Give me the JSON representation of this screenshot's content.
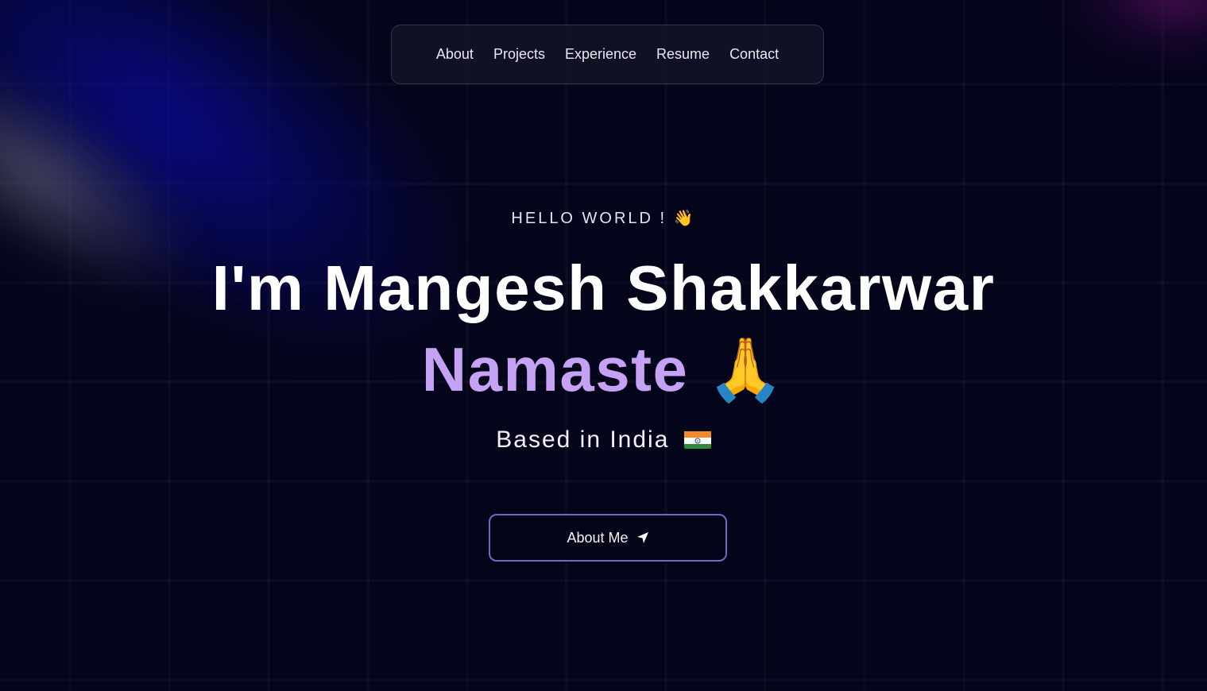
{
  "nav": {
    "items": [
      {
        "label": "About"
      },
      {
        "label": "Projects"
      },
      {
        "label": "Experience"
      },
      {
        "label": "Resume"
      },
      {
        "label": "Contact"
      }
    ]
  },
  "hero": {
    "greeting": "HELLO WORLD ! 👋",
    "name": "I'm Mangesh Shakkarwar",
    "namaste_word": "Namaste",
    "namaste_emoji": "🙏",
    "location_text": "Based in India",
    "flag_icon": "india-flag-icon"
  },
  "cta": {
    "label": "About Me",
    "icon": "navigation-arrow-icon"
  },
  "colors": {
    "background": "#04041a",
    "accent_purple": "#c6a2f5",
    "button_border": "#7765c7"
  }
}
